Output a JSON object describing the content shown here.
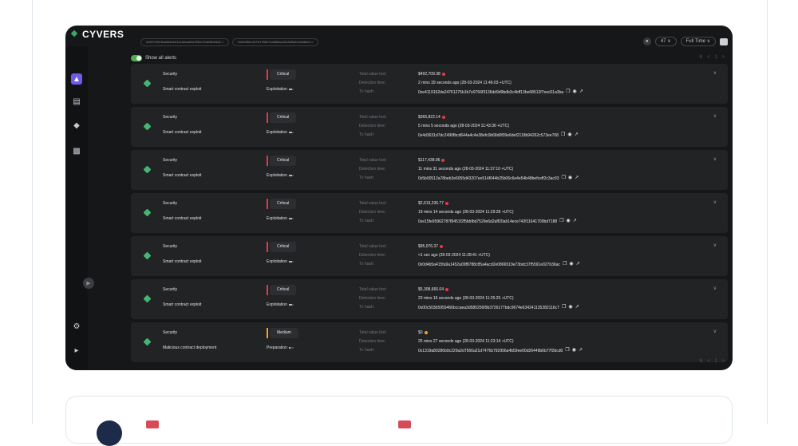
{
  "app": {
    "brand": "CYVERS"
  },
  "filters": {
    "chip_1": "0x507c0fc3ba3a5e1b1e1a9aa94e3f30c7b3e5fb64e8 ×",
    "chip_2": "0x6c0f6ec3c7b1768e7bd9d8ac42d3d9a2c9c6d6a3 ×",
    "show_all_label": "Show all alerts",
    "range_select": "Full Time ∨",
    "small_select": "47 ∨"
  },
  "pager": "K < 1 >",
  "field_labels": {
    "loss": "Total value lost:",
    "detected": "Detection time:",
    "tx": "Tx hash:"
  },
  "alerts": [
    {
      "category": "Security",
      "type": "Smart contract exploit",
      "severity": "Critical",
      "stage": "Exploitation",
      "stage_level": 2,
      "loss": "$492,709.38",
      "time": "2 mins 39 seconds ago (28-03-2024 11:46:03 +UTC)",
      "tx": "0xe4119162da24761275b1b7e9766f3136dd9d9bdb3c4bff13be68512f7eed11a3ba"
    },
    {
      "category": "Security",
      "type": "Smart contract exploit",
      "severity": "Critical",
      "stage": "Exploitation",
      "stage_level": 2,
      "loss": "$365,822.14",
      "time": "5 mins 5 seconds ago (28-03-2024 11:43:36 +UTC)",
      "tx": "0x4d3631d7dc2490fbcd644a4c4e38efc0b68d0f09e6def2118b94262c573ee708"
    },
    {
      "category": "Security",
      "type": "Smart contract exploit",
      "severity": "Critical",
      "stage": "Exploitation",
      "stage_level": 2,
      "loss": "$117,438.96",
      "time": "11 mins 31 seconds ago (28-03-2024 11:37:10 +UTC)",
      "tx": "0x5b00512a78beb3e6055d43207ee514f044b25b06c6e4e54b48befceff2c3ac93"
    },
    {
      "category": "Security",
      "type": "Smart contract exploit",
      "severity": "Critical",
      "stage": "Exploitation",
      "stage_level": 2,
      "loss": "$2,619,236.77",
      "time": "19 mins 14 seconds ago (28-03-2024 11:29:28 +UTC)",
      "tx": "0xe15fe95962787f8451f2f5bbfbd7529e6d2aff20ab14ece743f11641700bd7188"
    },
    {
      "category": "Security",
      "type": "Smart contract exploit",
      "severity": "Critical",
      "stage": "Exploitation",
      "stage_level": 2,
      "loss": "$95,076.37",
      "time": "<1 sec ago (28-03-2024 11:28:41 +UTC)",
      "tx": "0x0d4b5a415fa9a1452a09f8788c85a4acd2e0866519e73bdc37f5591e027b36ac"
    },
    {
      "category": "Security",
      "type": "Smart contract exploit",
      "severity": "Critical",
      "stage": "Exploitation",
      "stage_level": 2,
      "loss": "$5,308,666.04",
      "time": "23 mins 16 seconds ago (28-03-2024 11:25:25 +UTC)",
      "tx": "0x00c503b5959466bccaea3d580256f9b3726177bdc9674e634241135282116c7"
    },
    {
      "category": "Security",
      "type": "Malicious contract deployment",
      "severity": "Medium",
      "stage": "Preparation",
      "stage_level": 1,
      "loss": "$0",
      "time": "25 mins 27 seconds ago (28-03-2024 11:23:14 +UTC)",
      "tx": "0x1319a80286b9c229a2d7566a21d7476b792956a4b59ee00d26449b6b77f2bcd0"
    }
  ],
  "colors": {
    "critical": "#e53945",
    "medium": "#f2a322",
    "accent": "#6c5ce7",
    "brand_green": "#3ea86a"
  },
  "sidebar_icons": [
    "alert-icon",
    "inbox-icon",
    "shield-icon",
    "report-icon",
    "settings-icon",
    "logout-icon"
  ]
}
